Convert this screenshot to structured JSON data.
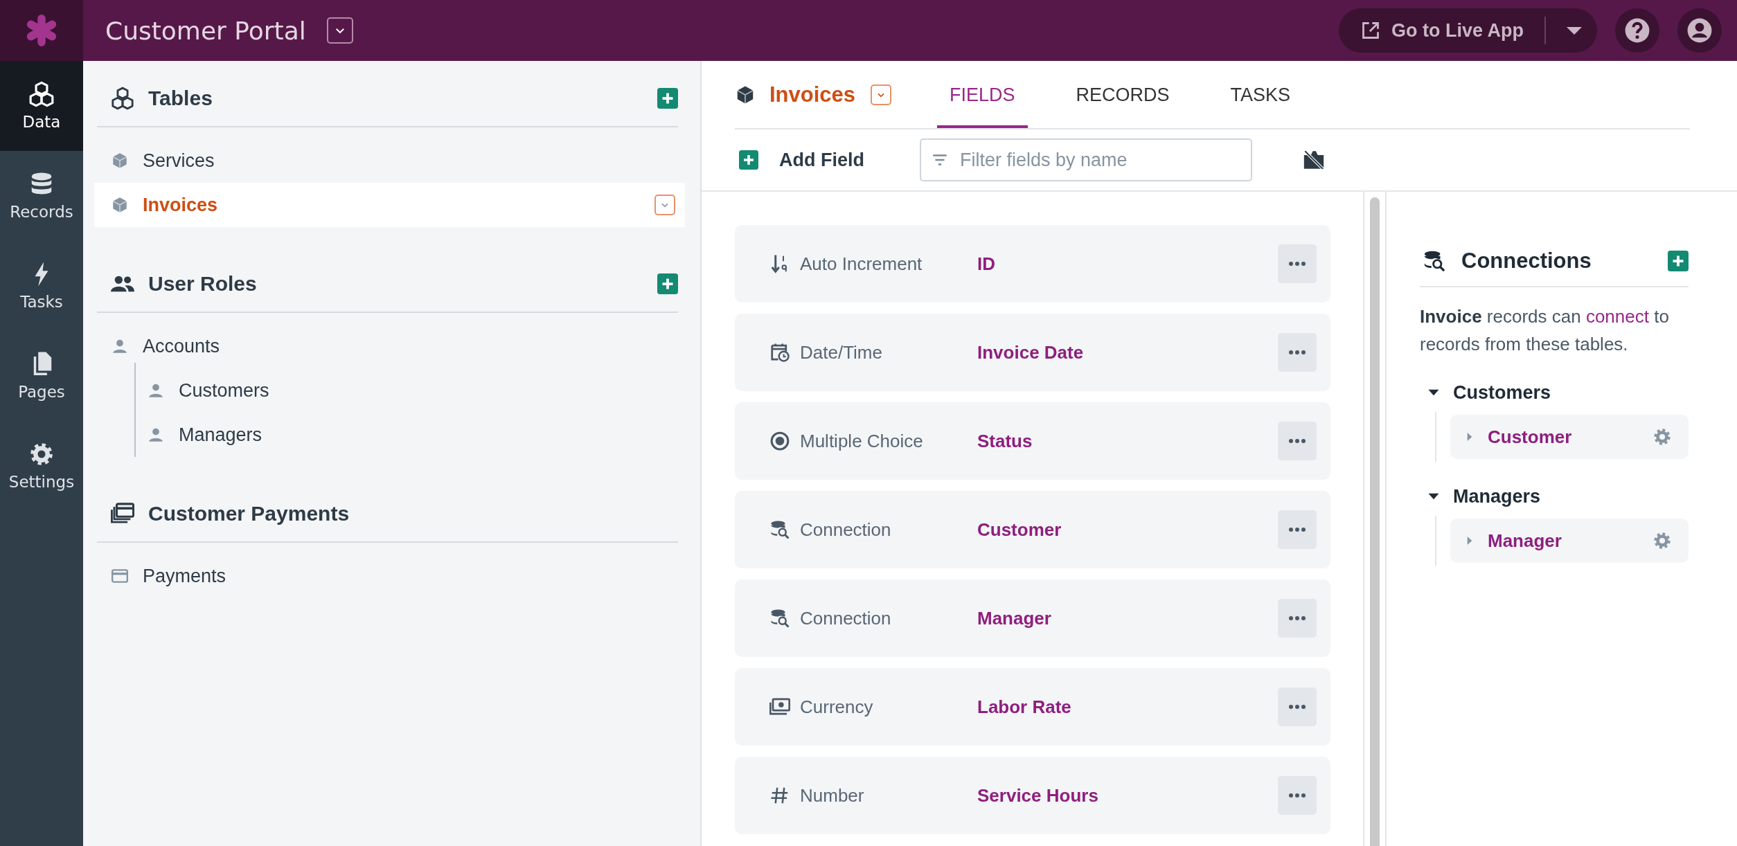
{
  "app": {
    "title": "Customer Portal"
  },
  "top_bar": {
    "live_app_button": "Go to Live App"
  },
  "nav": [
    {
      "label": "Data",
      "kind": "data",
      "selected": true
    },
    {
      "label": "Records",
      "kind": "records",
      "selected": false
    },
    {
      "label": "Tasks",
      "kind": "tasks",
      "selected": false
    },
    {
      "label": "Pages",
      "kind": "pages",
      "selected": false
    },
    {
      "label": "Settings",
      "kind": "settings",
      "selected": false
    }
  ],
  "sections": [
    {
      "title": "Tables",
      "kind": "tables",
      "add_button": true,
      "items": [
        {
          "label": "Services",
          "kind": "table",
          "selected": false
        },
        {
          "label": "Invoices",
          "kind": "table",
          "selected": true
        }
      ]
    },
    {
      "title": "User Roles",
      "kind": "roles",
      "add_button": true,
      "items": [
        {
          "label": "Accounts",
          "kind": "role",
          "selected": false,
          "children": [
            {
              "label": "Customers",
              "kind": "role",
              "selected": false
            },
            {
              "label": "Managers",
              "kind": "role",
              "selected": false
            }
          ]
        }
      ]
    },
    {
      "title": "Customer Payments",
      "kind": "payments",
      "add_button": false,
      "items": [
        {
          "label": "Payments",
          "kind": "payment",
          "selected": false
        }
      ]
    }
  ],
  "table_header": {
    "title": "Invoices",
    "tabs": [
      {
        "label": "FIELDS",
        "selected": true
      },
      {
        "label": "RECORDS",
        "selected": false
      },
      {
        "label": "TASKS",
        "selected": false
      }
    ]
  },
  "toolbar": {
    "add_field": "Add Field",
    "filter": {
      "placeholder": "Filter fields by name"
    }
  },
  "fields": [
    {
      "type": "Auto Increment",
      "kind": "auto_increment",
      "name": "ID"
    },
    {
      "type": "Date/Time",
      "kind": "date_time",
      "name": "Invoice Date"
    },
    {
      "type": "Multiple Choice",
      "kind": "multiple_choice",
      "name": "Status"
    },
    {
      "type": "Connection",
      "kind": "connection",
      "name": "Customer"
    },
    {
      "type": "Connection",
      "kind": "connection",
      "name": "Manager"
    },
    {
      "type": "Currency",
      "kind": "currency",
      "name": "Labor Rate"
    },
    {
      "type": "Number",
      "kind": "number",
      "name": "Service Hours"
    }
  ],
  "connections": {
    "title": "Connections",
    "description": {
      "before": "**Invoice** records can ",
      "link": "connect",
      "after": " to records from these tables."
    },
    "groups": [
      {
        "label": "Customers",
        "expanded": true,
        "items": [
          {
            "label": "Customer",
            "expanded": false
          }
        ]
      },
      {
        "label": "Managers",
        "expanded": true,
        "items": [
          {
            "label": "Manager",
            "expanded": false
          }
        ]
      }
    ]
  }
}
